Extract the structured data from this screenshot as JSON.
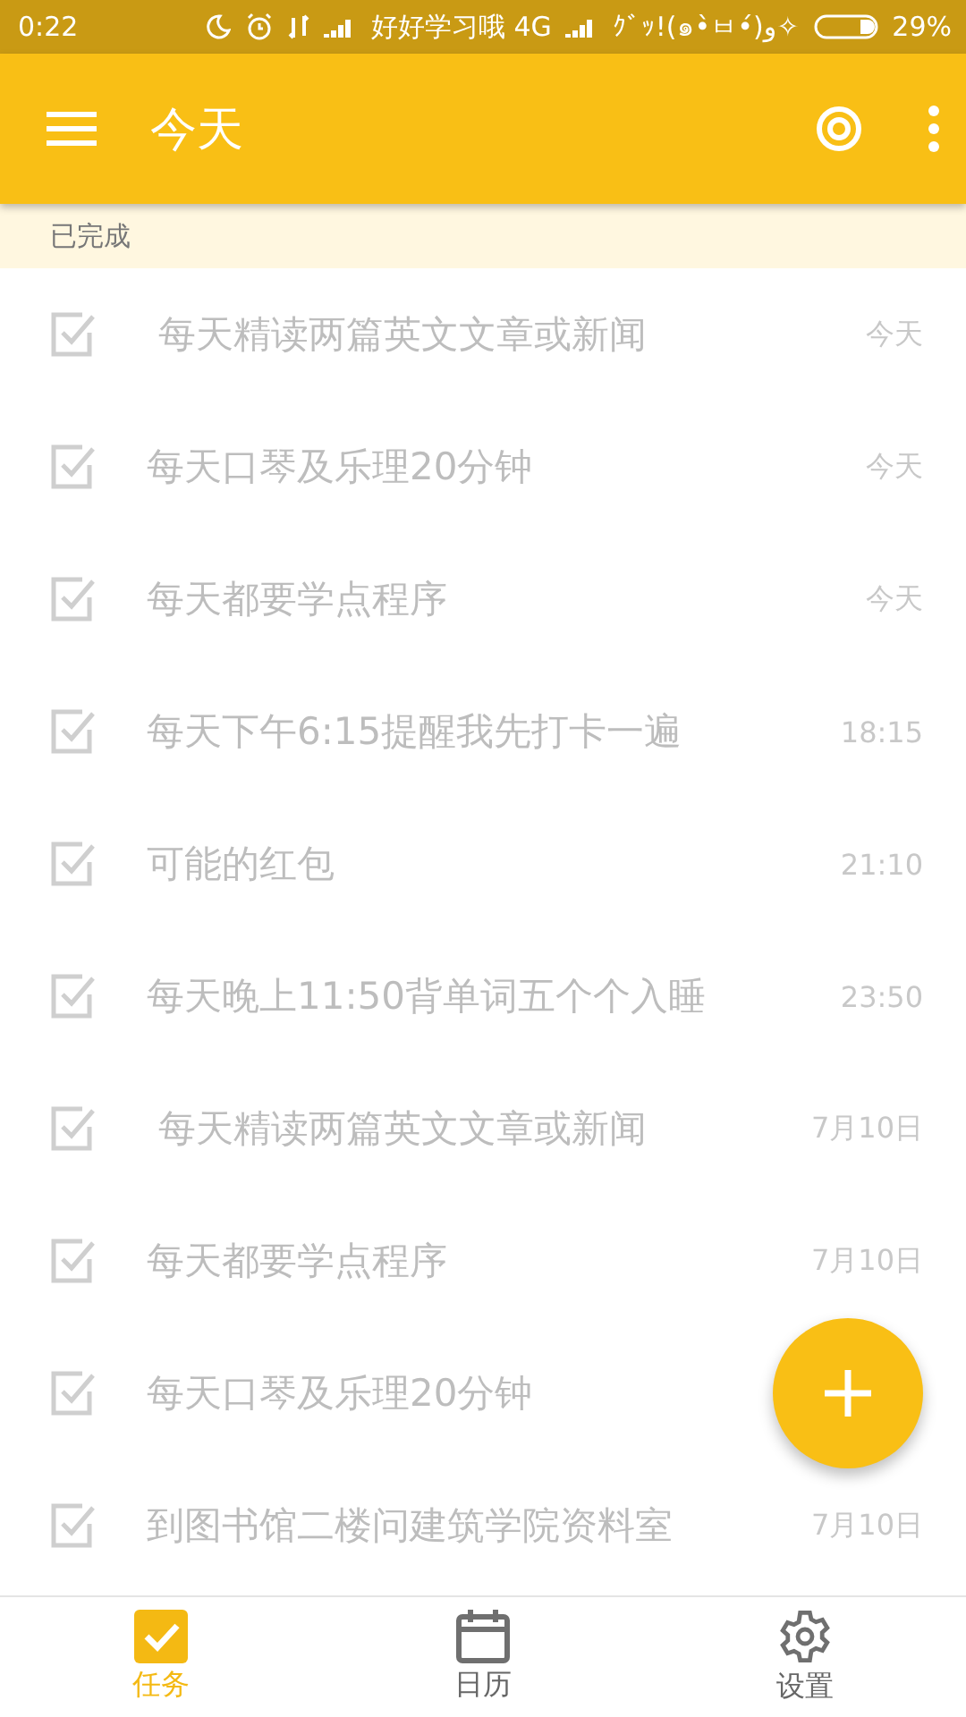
{
  "status_bar": {
    "time": "0:22",
    "carrier_1": "好好学习哦 4G",
    "carrier_2": "ｸﾞｯ!(๑•̀ㅂ•́)و✧",
    "battery": "29%"
  },
  "toolbar": {
    "title": "今天"
  },
  "section": {
    "title": "已完成"
  },
  "tasks": [
    {
      "title": " 每天精读两篇英文文章或新闻",
      "date": "今天",
      "checked": true
    },
    {
      "title": "每天口琴及乐理20分钟",
      "date": "今天",
      "checked": true
    },
    {
      "title": "每天都要学点程序",
      "date": "今天",
      "checked": true
    },
    {
      "title": "每天下午6:15提醒我先打卡一遍",
      "date": "18:15",
      "checked": true
    },
    {
      "title": "可能的红包",
      "date": "21:10",
      "checked": true
    },
    {
      "title": "每天晚上11:50背单词五个个入睡",
      "date": "23:50",
      "checked": true
    },
    {
      "title": " 每天精读两篇英文文章或新闻",
      "date": "7月10日",
      "checked": true
    },
    {
      "title": "每天都要学点程序",
      "date": "7月10日",
      "checked": true
    },
    {
      "title": "每天口琴及乐理20分钟",
      "checked": true
    },
    {
      "title": "到图书馆二楼问建筑学院资料室",
      "date": "7月10日",
      "checked": true
    }
  ],
  "bottom_nav": [
    {
      "label": "任务",
      "kind": "tasks",
      "selected": true
    },
    {
      "label": "日历",
      "kind": "calendar",
      "selected": false
    },
    {
      "label": "设置",
      "kind": "settings",
      "selected": false
    }
  ]
}
